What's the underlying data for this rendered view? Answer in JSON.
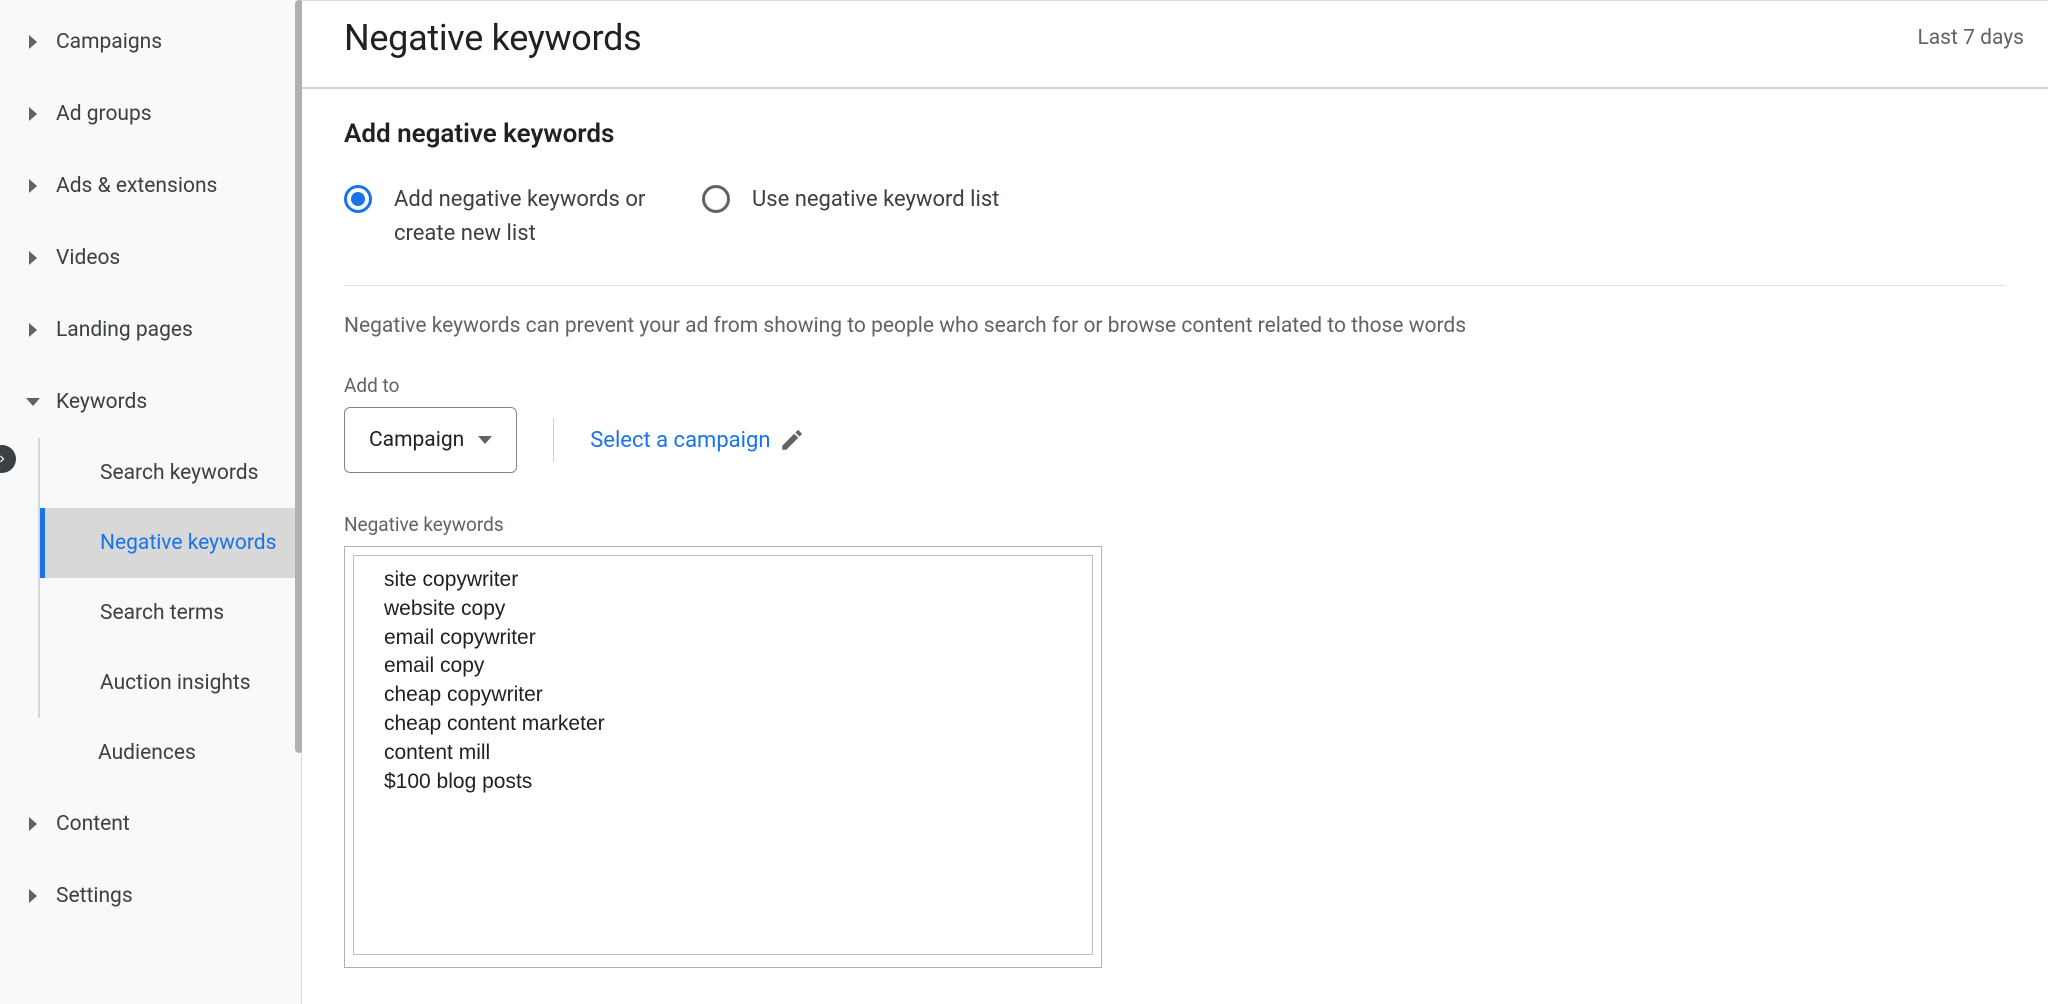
{
  "sidebar": {
    "items": [
      {
        "label": "Campaigns",
        "expanded": false
      },
      {
        "label": "Ad groups",
        "expanded": false
      },
      {
        "label": "Ads & extensions",
        "expanded": false
      },
      {
        "label": "Videos",
        "expanded": false
      },
      {
        "label": "Landing pages",
        "expanded": false
      },
      {
        "label": "Keywords",
        "expanded": true
      }
    ],
    "sub_items_keywords": [
      {
        "label": "Search keywords",
        "active": false
      },
      {
        "label": "Negative keywords",
        "active": true
      },
      {
        "label": "Search terms",
        "active": false
      },
      {
        "label": "Auction insights",
        "active": false
      }
    ],
    "after_sub_items": [
      {
        "label": "Audiences"
      }
    ],
    "tail_items": [
      {
        "label": "Content",
        "expanded": false
      },
      {
        "label": "Settings",
        "expanded": false
      }
    ]
  },
  "page": {
    "title": "Negative keywords",
    "date_range": "Last 7 days"
  },
  "form": {
    "section_title": "Add negative keywords",
    "radio_options": [
      {
        "label": "Add negative keywords or create new list",
        "selected": true
      },
      {
        "label": "Use negative keyword list",
        "selected": false
      }
    ],
    "helper_text": "Negative keywords can prevent your ad from showing to people who search for or browse content related to those words",
    "add_to_label": "Add to",
    "add_to_value": "Campaign",
    "select_campaign_label": "Select a campaign",
    "neg_kw_label": "Negative keywords",
    "neg_kw_text": "site copywriter\nwebsite copy\nemail copywriter\nemail copy\ncheap copywriter\ncheap content marketer\ncontent mill\n$100 blog posts"
  }
}
